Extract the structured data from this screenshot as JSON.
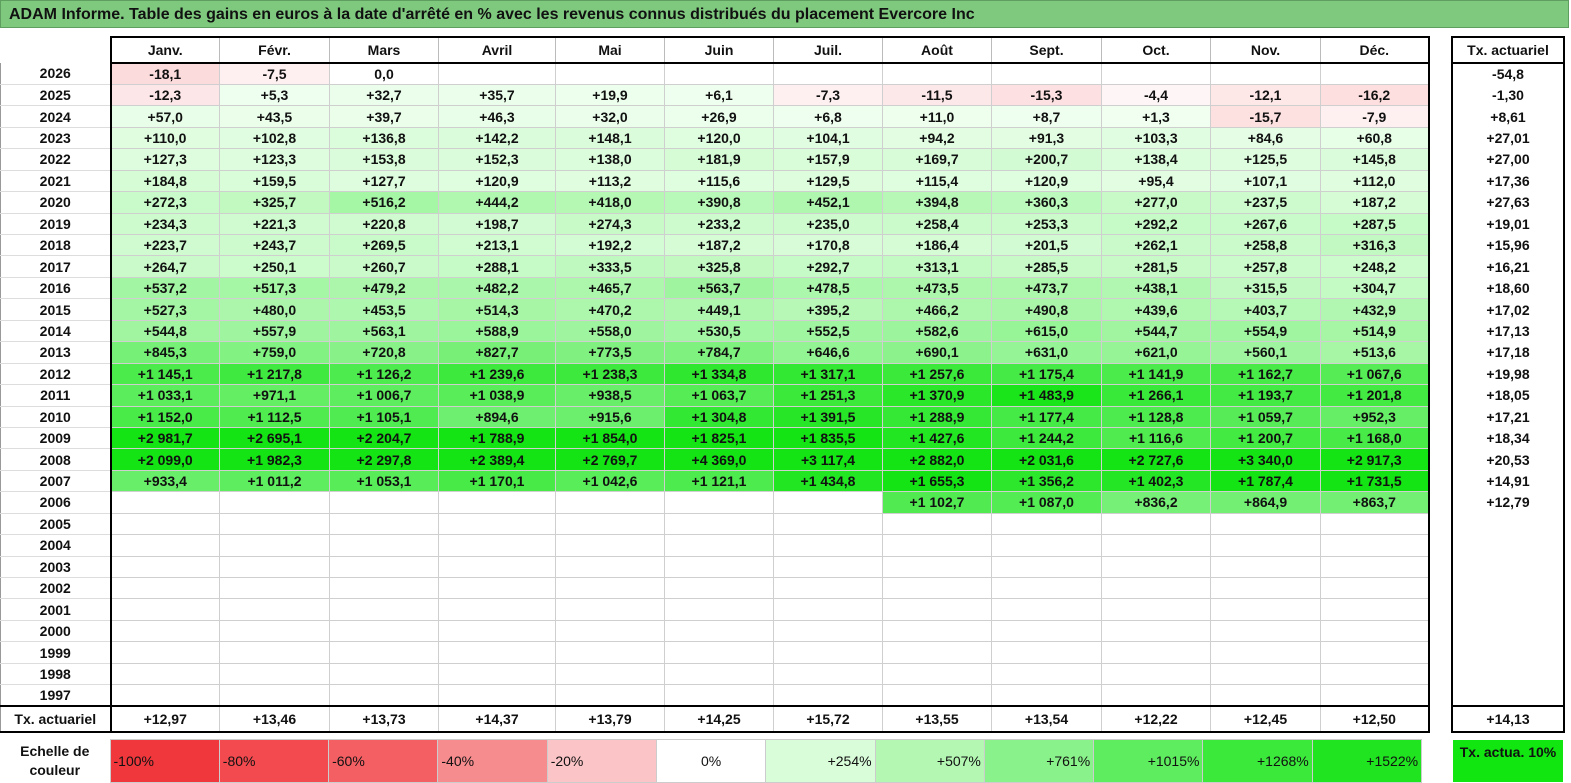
{
  "title": "ADAM Informe. Table des gains en euros à la date d'arrêté en % avec les revenus connus distribués du placement Evercore Inc",
  "months": [
    "Janv.",
    "Févr.",
    "Mars",
    "Avril",
    "Mai",
    "Juin",
    "Juil.",
    "Août",
    "Sept.",
    "Oct.",
    "Nov.",
    "Déc."
  ],
  "side_header": "Tx. actuariel",
  "rows": [
    {
      "year": "2026",
      "cells": [
        "-18,1",
        "-7,5",
        "0,0",
        "",
        "",
        "",
        "",
        "",
        "",
        "",
        "",
        ""
      ],
      "tx": "-54,8"
    },
    {
      "year": "2025",
      "cells": [
        "-12,3",
        "+5,3",
        "+32,7",
        "+35,7",
        "+19,9",
        "+6,1",
        "-7,3",
        "-11,5",
        "-15,3",
        "-4,4",
        "-12,1",
        "-16,2"
      ],
      "tx": "-1,30"
    },
    {
      "year": "2024",
      "cells": [
        "+57,0",
        "+43,5",
        "+39,7",
        "+46,3",
        "+32,0",
        "+26,9",
        "+6,8",
        "+11,0",
        "+8,7",
        "+1,3",
        "-15,7",
        "-7,9"
      ],
      "tx": "+8,61"
    },
    {
      "year": "2023",
      "cells": [
        "+110,0",
        "+102,8",
        "+136,8",
        "+142,2",
        "+148,1",
        "+120,0",
        "+104,1",
        "+94,2",
        "+91,3",
        "+103,3",
        "+84,6",
        "+60,8"
      ],
      "tx": "+27,01"
    },
    {
      "year": "2022",
      "cells": [
        "+127,3",
        "+123,3",
        "+153,8",
        "+152,3",
        "+138,0",
        "+181,9",
        "+157,9",
        "+169,7",
        "+200,7",
        "+138,4",
        "+125,5",
        "+145,8"
      ],
      "tx": "+27,00"
    },
    {
      "year": "2021",
      "cells": [
        "+184,8",
        "+159,5",
        "+127,7",
        "+120,9",
        "+113,2",
        "+115,6",
        "+129,5",
        "+115,4",
        "+120,9",
        "+95,4",
        "+107,1",
        "+112,0"
      ],
      "tx": "+17,36"
    },
    {
      "year": "2020",
      "cells": [
        "+272,3",
        "+325,7",
        "+516,2",
        "+444,2",
        "+418,0",
        "+390,8",
        "+452,1",
        "+394,8",
        "+360,3",
        "+277,0",
        "+237,5",
        "+187,2"
      ],
      "tx": "+27,63"
    },
    {
      "year": "2019",
      "cells": [
        "+234,3",
        "+221,3",
        "+220,8",
        "+198,7",
        "+274,3",
        "+233,2",
        "+235,0",
        "+258,4",
        "+253,3",
        "+292,2",
        "+267,6",
        "+287,5"
      ],
      "tx": "+19,01"
    },
    {
      "year": "2018",
      "cells": [
        "+223,7",
        "+243,7",
        "+269,5",
        "+213,1",
        "+192,2",
        "+187,2",
        "+170,8",
        "+186,4",
        "+201,5",
        "+262,1",
        "+258,8",
        "+316,3"
      ],
      "tx": "+15,96"
    },
    {
      "year": "2017",
      "cells": [
        "+264,7",
        "+250,1",
        "+260,7",
        "+288,1",
        "+333,5",
        "+325,8",
        "+292,7",
        "+313,1",
        "+285,5",
        "+281,5",
        "+257,8",
        "+248,2"
      ],
      "tx": "+16,21"
    },
    {
      "year": "2016",
      "cells": [
        "+537,2",
        "+517,3",
        "+479,2",
        "+482,2",
        "+465,7",
        "+563,7",
        "+478,5",
        "+473,5",
        "+473,7",
        "+438,1",
        "+315,5",
        "+304,7"
      ],
      "tx": "+18,60"
    },
    {
      "year": "2015",
      "cells": [
        "+527,3",
        "+480,0",
        "+453,5",
        "+514,3",
        "+470,2",
        "+449,1",
        "+395,2",
        "+466,2",
        "+490,8",
        "+439,6",
        "+403,7",
        "+432,9"
      ],
      "tx": "+17,02"
    },
    {
      "year": "2014",
      "cells": [
        "+544,8",
        "+557,9",
        "+563,1",
        "+588,9",
        "+558,0",
        "+530,5",
        "+552,5",
        "+582,6",
        "+615,0",
        "+544,7",
        "+554,9",
        "+514,9"
      ],
      "tx": "+17,13"
    },
    {
      "year": "2013",
      "cells": [
        "+845,3",
        "+759,0",
        "+720,8",
        "+827,7",
        "+773,5",
        "+784,7",
        "+646,6",
        "+690,1",
        "+631,0",
        "+621,0",
        "+560,1",
        "+513,6"
      ],
      "tx": "+17,18"
    },
    {
      "year": "2012",
      "cells": [
        "+1 145,1",
        "+1 217,8",
        "+1 126,2",
        "+1 239,6",
        "+1 238,3",
        "+1 334,8",
        "+1 317,1",
        "+1 257,6",
        "+1 175,4",
        "+1 141,9",
        "+1 162,7",
        "+1 067,6"
      ],
      "tx": "+19,98"
    },
    {
      "year": "2011",
      "cells": [
        "+1 033,1",
        "+971,1",
        "+1 006,7",
        "+1 038,9",
        "+938,5",
        "+1 063,7",
        "+1 251,3",
        "+1 370,9",
        "+1 483,9",
        "+1 266,1",
        "+1 193,7",
        "+1 201,8"
      ],
      "tx": "+18,05"
    },
    {
      "year": "2010",
      "cells": [
        "+1 152,0",
        "+1 112,5",
        "+1 105,1",
        "+894,6",
        "+915,6",
        "+1 304,8",
        "+1 391,5",
        "+1 288,9",
        "+1 177,4",
        "+1 128,8",
        "+1 059,7",
        "+952,3"
      ],
      "tx": "+17,21"
    },
    {
      "year": "2009",
      "cells": [
        "+2 981,7",
        "+2 695,1",
        "+2 204,7",
        "+1 788,9",
        "+1 854,0",
        "+1 825,1",
        "+1 835,5",
        "+1 427,6",
        "+1 244,2",
        "+1 116,6",
        "+1 200,7",
        "+1 168,0"
      ],
      "tx": "+18,34"
    },
    {
      "year": "2008",
      "cells": [
        "+2 099,0",
        "+1 982,3",
        "+2 297,8",
        "+2 389,4",
        "+2 769,7",
        "+4 369,0",
        "+3 117,4",
        "+2 882,0",
        "+2 031,6",
        "+2 727,6",
        "+3 340,0",
        "+2 917,3"
      ],
      "tx": "+20,53"
    },
    {
      "year": "2007",
      "cells": [
        "+933,4",
        "+1 011,2",
        "+1 053,1",
        "+1 170,1",
        "+1 042,6",
        "+1 121,1",
        "+1 434,8",
        "+1 655,3",
        "+1 356,2",
        "+1 402,3",
        "+1 787,4",
        "+1 731,5"
      ],
      "tx": "+14,91"
    },
    {
      "year": "2006",
      "cells": [
        "",
        "",
        "",
        "",
        "",
        "",
        "",
        "+1 102,7",
        "+1 087,0",
        "+836,2",
        "+864,9",
        "+863,7"
      ],
      "tx": "+12,79"
    },
    {
      "year": "2005",
      "cells": [
        "",
        "",
        "",
        "",
        "",
        "",
        "",
        "",
        "",
        "",
        "",
        ""
      ],
      "tx": ""
    },
    {
      "year": "2004",
      "cells": [
        "",
        "",
        "",
        "",
        "",
        "",
        "",
        "",
        "",
        "",
        "",
        ""
      ],
      "tx": ""
    },
    {
      "year": "2003",
      "cells": [
        "",
        "",
        "",
        "",
        "",
        "",
        "",
        "",
        "",
        "",
        "",
        ""
      ],
      "tx": ""
    },
    {
      "year": "2002",
      "cells": [
        "",
        "",
        "",
        "",
        "",
        "",
        "",
        "",
        "",
        "",
        "",
        ""
      ],
      "tx": ""
    },
    {
      "year": "2001",
      "cells": [
        "",
        "",
        "",
        "",
        "",
        "",
        "",
        "",
        "",
        "",
        "",
        ""
      ],
      "tx": ""
    },
    {
      "year": "2000",
      "cells": [
        "",
        "",
        "",
        "",
        "",
        "",
        "",
        "",
        "",
        "",
        "",
        ""
      ],
      "tx": ""
    },
    {
      "year": "1999",
      "cells": [
        "",
        "",
        "",
        "",
        "",
        "",
        "",
        "",
        "",
        "",
        "",
        ""
      ],
      "tx": ""
    },
    {
      "year": "1998",
      "cells": [
        "",
        "",
        "",
        "",
        "",
        "",
        "",
        "",
        "",
        "",
        "",
        ""
      ],
      "tx": ""
    },
    {
      "year": "1997",
      "cells": [
        "",
        "",
        "",
        "",
        "",
        "",
        "",
        "",
        "",
        "",
        "",
        ""
      ],
      "tx": ""
    }
  ],
  "average_row": {
    "label": "Tx. actuariel",
    "cells": [
      "+12,97",
      "+13,46",
      "+13,73",
      "+14,37",
      "+13,79",
      "+14,25",
      "+15,72",
      "+13,55",
      "+13,54",
      "+12,22",
      "+12,45",
      "+12,50"
    ],
    "tx": "+14,13"
  },
  "legend": {
    "label": "Echelle de couleur",
    "items": [
      {
        "text": "-100%",
        "color": "#f0373c",
        "align": "left"
      },
      {
        "text": "-80%",
        "color": "#f24a4e",
        "align": "left"
      },
      {
        "text": "-60%",
        "color": "#f45f63",
        "align": "left"
      },
      {
        "text": "-40%",
        "color": "#f78c8f",
        "align": "left"
      },
      {
        "text": "-20%",
        "color": "#fbc4c6",
        "align": "left"
      },
      {
        "text": "0%",
        "color": "#ffffff",
        "align": "center"
      },
      {
        "text": "+254%",
        "color": "#d9fcd9",
        "align": "right"
      },
      {
        "text": "+507%",
        "color": "#b3f7b3",
        "align": "right"
      },
      {
        "text": "+761%",
        "color": "#8af28a",
        "align": "right"
      },
      {
        "text": "+1015%",
        "color": "#5eed5e",
        "align": "right"
      },
      {
        "text": "+1268%",
        "color": "#3be93b",
        "align": "right"
      },
      {
        "text": "+1522%",
        "color": "#1fe41f",
        "align": "right"
      }
    ],
    "tx_label": "Tx. actua. 10%",
    "tx_color": "#11e611"
  }
}
